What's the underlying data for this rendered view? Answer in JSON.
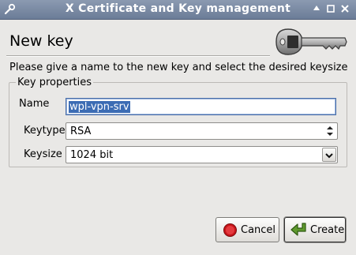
{
  "window": {
    "title": "X Certificate and Key management"
  },
  "header": {
    "heading": "New key",
    "description": "Please give a name to the new key and select the desired keysize"
  },
  "key_properties": {
    "group_label": "Key properties",
    "name_label": "Name",
    "name_value": "wpl-vpn-srv",
    "keytype_label": "Keytype",
    "keytype_value": "RSA",
    "keysize_label": "Keysize",
    "keysize_value": "1024 bit"
  },
  "buttons": {
    "cancel": "Cancel",
    "create": "Create"
  },
  "colors": {
    "titlebar": "#7a8aa4",
    "selection": "#3c6cb4",
    "window_bg": "#e9e8e6"
  }
}
